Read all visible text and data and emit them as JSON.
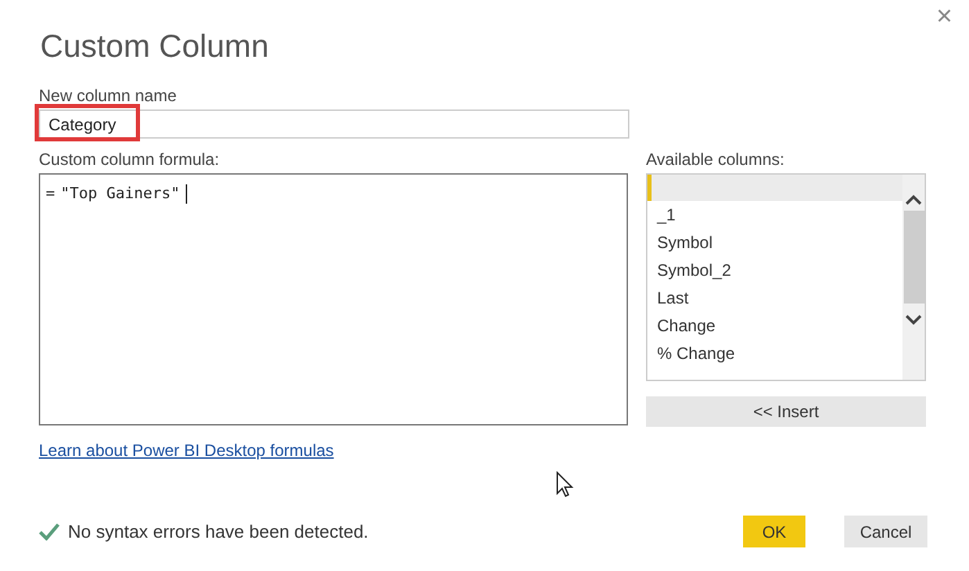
{
  "window": {
    "title": "Custom Column",
    "close": "×"
  },
  "name_field": {
    "label": "New column name",
    "value": "Category",
    "highlighted": true
  },
  "formula": {
    "label": "Custom column formula:",
    "prefix": "=",
    "value": "\"Top Gainers\""
  },
  "available_columns": {
    "label": "Available columns:",
    "blank_row_selected": true,
    "items": [
      {
        "label": "_1",
        "selected": false
      },
      {
        "label": "Symbol",
        "selected": false
      },
      {
        "label": "Symbol_2",
        "selected": false
      },
      {
        "label": "Last",
        "selected": false
      },
      {
        "label": "Change",
        "selected": false
      },
      {
        "label": "% Change",
        "selected": false
      }
    ],
    "insert_button": "<< Insert"
  },
  "link": "Learn about Power BI Desktop formulas",
  "status": {
    "ok": true,
    "text": "No syntax errors have been detected."
  },
  "buttons": [
    {
      "label": "OK",
      "kind": "primary"
    },
    {
      "label": "Cancel",
      "kind": "secondary"
    }
  ]
}
